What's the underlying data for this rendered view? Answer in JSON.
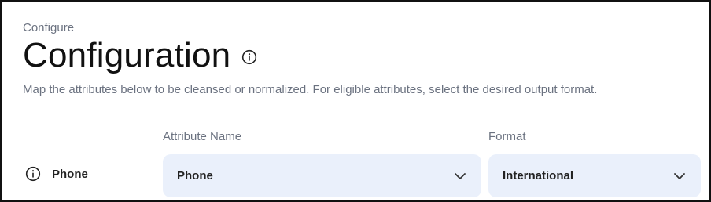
{
  "header": {
    "breadcrumb": "Configure",
    "title": "Configuration",
    "description": "Map the attributes below to be cleansed or normalized. For eligible attributes, select the desired output format."
  },
  "columns": {
    "attribute_name": "Attribute Name",
    "format": "Format"
  },
  "rows": [
    {
      "label": "Phone",
      "attribute_value": "Phone",
      "format_value": "International"
    }
  ],
  "icons": {
    "title": "info-icon",
    "row": "info-icon",
    "dropdown": "chevron-down-icon"
  },
  "colors": {
    "select_background": "#eaf0fb",
    "muted_text": "#6b7280",
    "primary_text": "#111111"
  }
}
